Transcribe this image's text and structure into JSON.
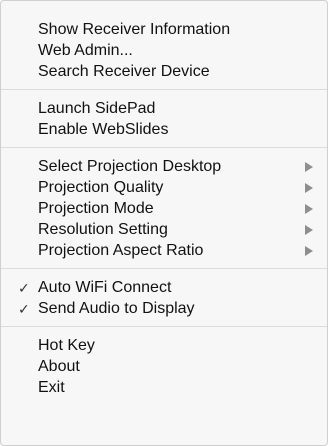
{
  "menu": {
    "group1": [
      {
        "label": "Show Receiver Information"
      },
      {
        "label": "Web Admin..."
      },
      {
        "label": "Search Receiver Device"
      }
    ],
    "group2": [
      {
        "label": "Launch SidePad"
      },
      {
        "label": "Enable WebSlides"
      }
    ],
    "group3": [
      {
        "label": "Select Projection Desktop",
        "submenu": true
      },
      {
        "label": "Projection Quality",
        "submenu": true
      },
      {
        "label": "Projection Mode",
        "submenu": true
      },
      {
        "label": "Resolution Setting",
        "submenu": true
      },
      {
        "label": "Projection Aspect Ratio",
        "submenu": true
      }
    ],
    "group4": [
      {
        "label": "Auto WiFi Connect",
        "checked": true,
        "check_glyph": "✓"
      },
      {
        "label": "Send Audio to Display",
        "checked": true,
        "check_glyph": "✓"
      }
    ],
    "group5": [
      {
        "label": "Hot Key"
      },
      {
        "label": "About"
      },
      {
        "label": "Exit"
      }
    ]
  },
  "icons": {
    "submenu_arrow": "triangle-right-icon",
    "check": "checkmark-icon"
  }
}
